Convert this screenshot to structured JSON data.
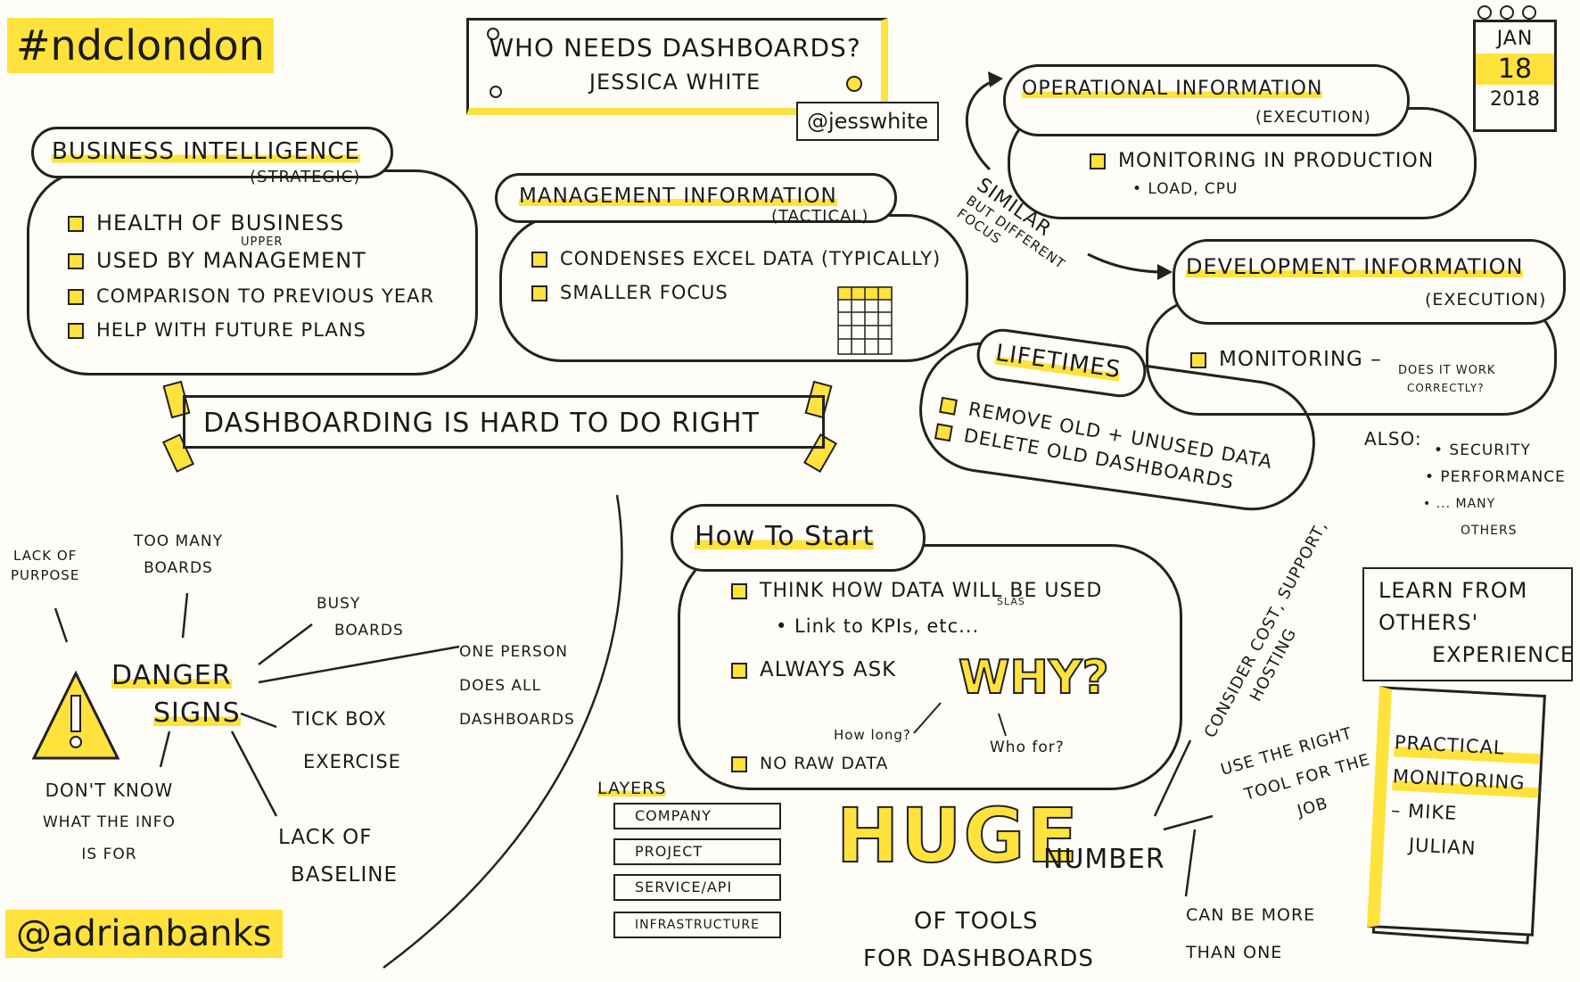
{
  "hashtag": "#ndclondon",
  "title": {
    "line1": "Who needs dashboards?",
    "speaker": "Jessica White",
    "twitter": "@jesswhite"
  },
  "date": {
    "month": "JAN",
    "day": "18",
    "year": "2018"
  },
  "author": "@adrianbanks",
  "business_intelligence": {
    "title": "Business Intelligence",
    "subtitle": "(Strategic)",
    "items": [
      "Health of business",
      "Used by management",
      "Comparison to previous year",
      "Help with future plans"
    ],
    "upper_note": "upper"
  },
  "management_information": {
    "title": "Management Information",
    "subtitle": "(Tactical)",
    "items": [
      "Condenses Excel data (typically)",
      "Smaller focus"
    ]
  },
  "operational_information": {
    "title": "Operational Information",
    "subtitle": "(Execution)",
    "item": "Monitoring in production",
    "sub": "• load, cpu"
  },
  "development_information": {
    "title": "Development Information",
    "subtitle": "(Execution)",
    "item": "Monitoring –",
    "note1": "does it work",
    "note2": "correctly?"
  },
  "similar_note": {
    "line1": "Similar",
    "line2": "but different",
    "line3": "focus"
  },
  "banner": "Dashboarding is hard to do right",
  "lifetimes": {
    "title": "Lifetimes",
    "items": [
      "Remove old + unused data",
      "Delete old dashboards"
    ]
  },
  "also": {
    "label": "Also:",
    "items": [
      "• Security",
      "• Performance",
      "• ... many",
      "others"
    ]
  },
  "learn": {
    "line1": "Learn from",
    "line2": "others'",
    "line3": "experience"
  },
  "how_to_start": {
    "title": "How To Start",
    "items": [
      "Think how data will be used",
      "Always ask",
      "No raw data"
    ],
    "sub": "• Link to KPIs, etc...",
    "slas": "SLAs",
    "why": "WHY?",
    "how_long": "How long?",
    "who_for": "Who for?"
  },
  "danger": {
    "line1": "Danger",
    "line2": "Signs",
    "lack_purpose": [
      "Lack of",
      "purpose"
    ],
    "too_many": [
      "Too many",
      "boards"
    ],
    "busy": [
      "Busy",
      "boards"
    ],
    "one_person": [
      "One person",
      "does all",
      "dashboards"
    ],
    "tick_box": [
      "Tick box",
      "exercise"
    ],
    "dont_know": [
      "Don't know",
      "what the info",
      "is for"
    ],
    "baseline": [
      "Lack of",
      "baseline"
    ]
  },
  "layers": {
    "title": "Layers",
    "items": [
      "Company",
      "Project",
      "Service/API",
      "Infrastructure"
    ]
  },
  "huge": {
    "big": "HUGE",
    "rest": "number",
    "line2": "of tools",
    "line3": "for dashboards"
  },
  "consider": {
    "line1": "Consider cost, support,",
    "line2": "hosting"
  },
  "right_tool": [
    "Use the right",
    "tool for the",
    "job"
  ],
  "more_than_one": [
    "Can be more",
    "than one"
  ],
  "book": {
    "line1": "Practical",
    "line2": "Monitoring",
    "line3": "– Mike",
    "line4": "Julian"
  },
  "colors": {
    "highlight": "#ffe23b",
    "ink": "#1a1a1a",
    "paper": "#fefdf8"
  }
}
